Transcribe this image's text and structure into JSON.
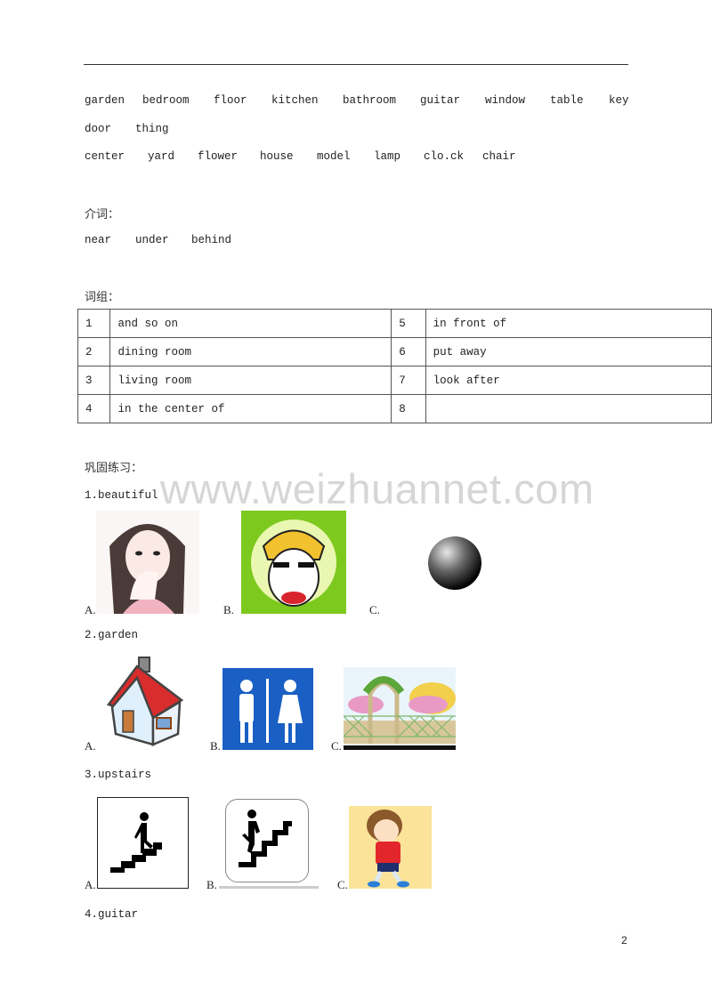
{
  "vocab": {
    "nouns_row1": [
      "garden",
      "bedroom",
      "floor",
      "kitchen",
      "bathroom",
      "guitar",
      "window",
      "table",
      "key"
    ],
    "nouns_row2": [
      "door",
      "thing"
    ],
    "nouns_row3": [
      "center",
      "yard",
      "flower",
      "house",
      "model",
      "lamp",
      "clo.ck",
      "chair"
    ]
  },
  "prepositions": {
    "heading": "介词：",
    "words": [
      "near",
      "under",
      "behind"
    ]
  },
  "phrases": {
    "heading": "词组：",
    "rows": [
      {
        "n1": "1",
        "p1": "and so on",
        "n2": "5",
        "p2": "in front of"
      },
      {
        "n1": "2",
        "p1": "dining room",
        "n2": "6",
        "p2": "put away"
      },
      {
        "n1": "3",
        "p1": "living room",
        "n2": "7",
        "p2": "look after"
      },
      {
        "n1": "4",
        "p1": "in the center of",
        "n2": "8",
        "p2": ""
      }
    ]
  },
  "exercises": {
    "heading": "巩固练习：",
    "questions": [
      {
        "label": "1.beautiful",
        "options": [
          {
            "letter": "A.",
            "image": "girl-smiling-illustration"
          },
          {
            "letter": "B.",
            "image": "crying-cartoon-girl"
          },
          {
            "letter": "C.",
            "image": "black-sphere"
          }
        ]
      },
      {
        "label": "2.garden",
        "options": [
          {
            "letter": "A.",
            "image": "house-cartoon"
          },
          {
            "letter": "B.",
            "image": "restroom-sign"
          },
          {
            "letter": "C.",
            "image": "garden-gate-illustration"
          }
        ]
      },
      {
        "label": "3.upstairs",
        "options": [
          {
            "letter": "A.",
            "image": "person-walking-stairs-icon"
          },
          {
            "letter": "B.",
            "image": "person-climbing-stairs-icon"
          },
          {
            "letter": "C.",
            "image": "walking-boy-cartoon"
          }
        ]
      },
      {
        "label": "4.guitar",
        "options": []
      }
    ]
  },
  "watermark": "www.weizhuannet.com",
  "page_number": "2"
}
